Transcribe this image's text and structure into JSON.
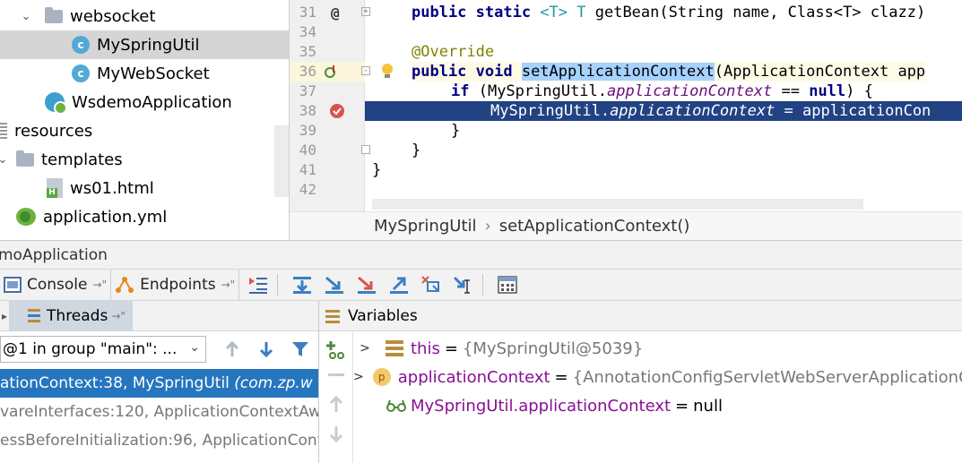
{
  "project_tree": {
    "items": [
      {
        "label": "websocket",
        "icon": "folder-icon",
        "expanded": true
      },
      {
        "label": "MySpringUtil",
        "icon": "class-icon",
        "selected": true
      },
      {
        "label": "MyWebSocket",
        "icon": "class-icon"
      },
      {
        "label": "WsdemoApplication",
        "icon": "spring-boot-app-icon"
      },
      {
        "label": "resources",
        "icon": "resources-folder-icon"
      },
      {
        "label": "templates",
        "icon": "folder-icon",
        "expanded": true
      },
      {
        "label": "ws01.html",
        "icon": "html-file-icon"
      },
      {
        "label": "application.yml",
        "icon": "yaml-file-icon"
      }
    ]
  },
  "editor": {
    "lines": [
      {
        "num": "31"
      },
      {
        "num": "34"
      },
      {
        "num": "35"
      },
      {
        "num": "36"
      },
      {
        "num": "37"
      },
      {
        "num": "38"
      },
      {
        "num": "39"
      },
      {
        "num": "40"
      },
      {
        "num": "41"
      },
      {
        "num": "42"
      }
    ],
    "code": {
      "l31_kw1": "public static ",
      "l31_gen1": "<T> ",
      "l31_gen2": "T ",
      "l31_rest": "getBean(String name, Class<T> clazz)",
      "l35_ann": "@Override",
      "l36_kw": "public void ",
      "l36_method": "setApplicationContext",
      "l36_rest": "(ApplicationContext app",
      "l37_kw": "if ",
      "l37_a": "(MySpringUtil.",
      "l37_it": "applicationContext",
      "l37_b": " == ",
      "l37_kw2": "null",
      "l37_c": ") {",
      "l38_a": "MySpringUtil.",
      "l38_it": "applicationContext",
      "l38_b": " = applicationCon",
      "l39": "}",
      "l40": "}",
      "l41": "}"
    },
    "breadcrumb": [
      "MySpringUtil",
      "setApplicationContext()"
    ],
    "breadcrumb_sep": "›"
  },
  "debug": {
    "title": "moApplication",
    "tabs": [
      {
        "label": "Console",
        "icon": "console-icon"
      },
      {
        "label": "Endpoints",
        "icon": "endpoints-icon"
      }
    ],
    "pin": "→\"",
    "threads_label": "Threads",
    "thread_select": "@1 in group \"main\": ...",
    "frames": [
      {
        "text": "ationContext:38, MySpringUtil ",
        "pkg": "(com.zp.w",
        "selected": true
      },
      {
        "text": "vareInterfaces:120, ApplicationContextAwa"
      },
      {
        "text": "essBeforeInitialization:96, ApplicationCont"
      }
    ],
    "variables_label": "Variables",
    "variables": [
      {
        "name": "this",
        "eq": "=",
        "value": "{MySpringUtil@5039}",
        "icon": "object-icon"
      },
      {
        "name": "applicationContext",
        "eq": "=",
        "value": "{AnnotationConfigServletWebServerApplicationCo",
        "icon": "parameter-icon"
      },
      {
        "name": "MySpringUtil.applicationContext",
        "eq": "=",
        "value": "null",
        "icon": "watch-icon"
      }
    ]
  },
  "colors": {
    "keyword": "#000080",
    "annotation": "#808000",
    "static_field": "#660e7a",
    "execution_line": "#214283",
    "selected_frame": "#2675bf",
    "variable_name": "#871094"
  }
}
